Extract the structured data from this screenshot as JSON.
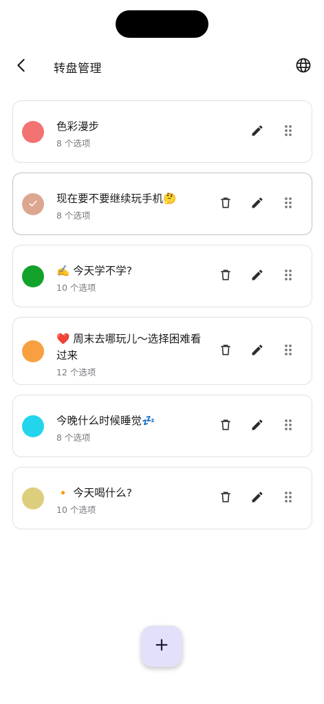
{
  "header": {
    "title": "转盘管理",
    "back_icon": "arrow-back-icon",
    "language_icon": "globe-icon"
  },
  "wheels": [
    {
      "name": "色彩漫步",
      "count": "8 个选项",
      "color": "#f37272",
      "selected": false,
      "deletable": false
    },
    {
      "name": "现在要不要继续玩手机🤔",
      "count": "8 个选项",
      "color": "#dda690",
      "selected": true,
      "deletable": true
    },
    {
      "name": "✍️ 今天学不学?",
      "count": "10 个选项",
      "color": "#12a22a",
      "selected": false,
      "deletable": true
    },
    {
      "name": "❤️ 周末去哪玩儿～选择困难看过来",
      "count": "12 个选项",
      "color": "#f8a040",
      "selected": false,
      "deletable": true
    },
    {
      "name": "今晚什么时候睡觉💤",
      "count": "8 个选项",
      "color": "#22d5ec",
      "selected": false,
      "deletable": true
    },
    {
      "name": "🔸 今天喝什么?",
      "count": "10 个选项",
      "color": "#ddce7e",
      "selected": false,
      "deletable": true
    }
  ],
  "icons": {
    "delete": "trash-icon",
    "edit": "pencil-icon",
    "drag": "drag-handle-icon",
    "selected": "check-icon",
    "add": "plus-icon"
  },
  "colors": {
    "fab_background": "#e2e1f9",
    "card_border": "#e1e1e6"
  }
}
